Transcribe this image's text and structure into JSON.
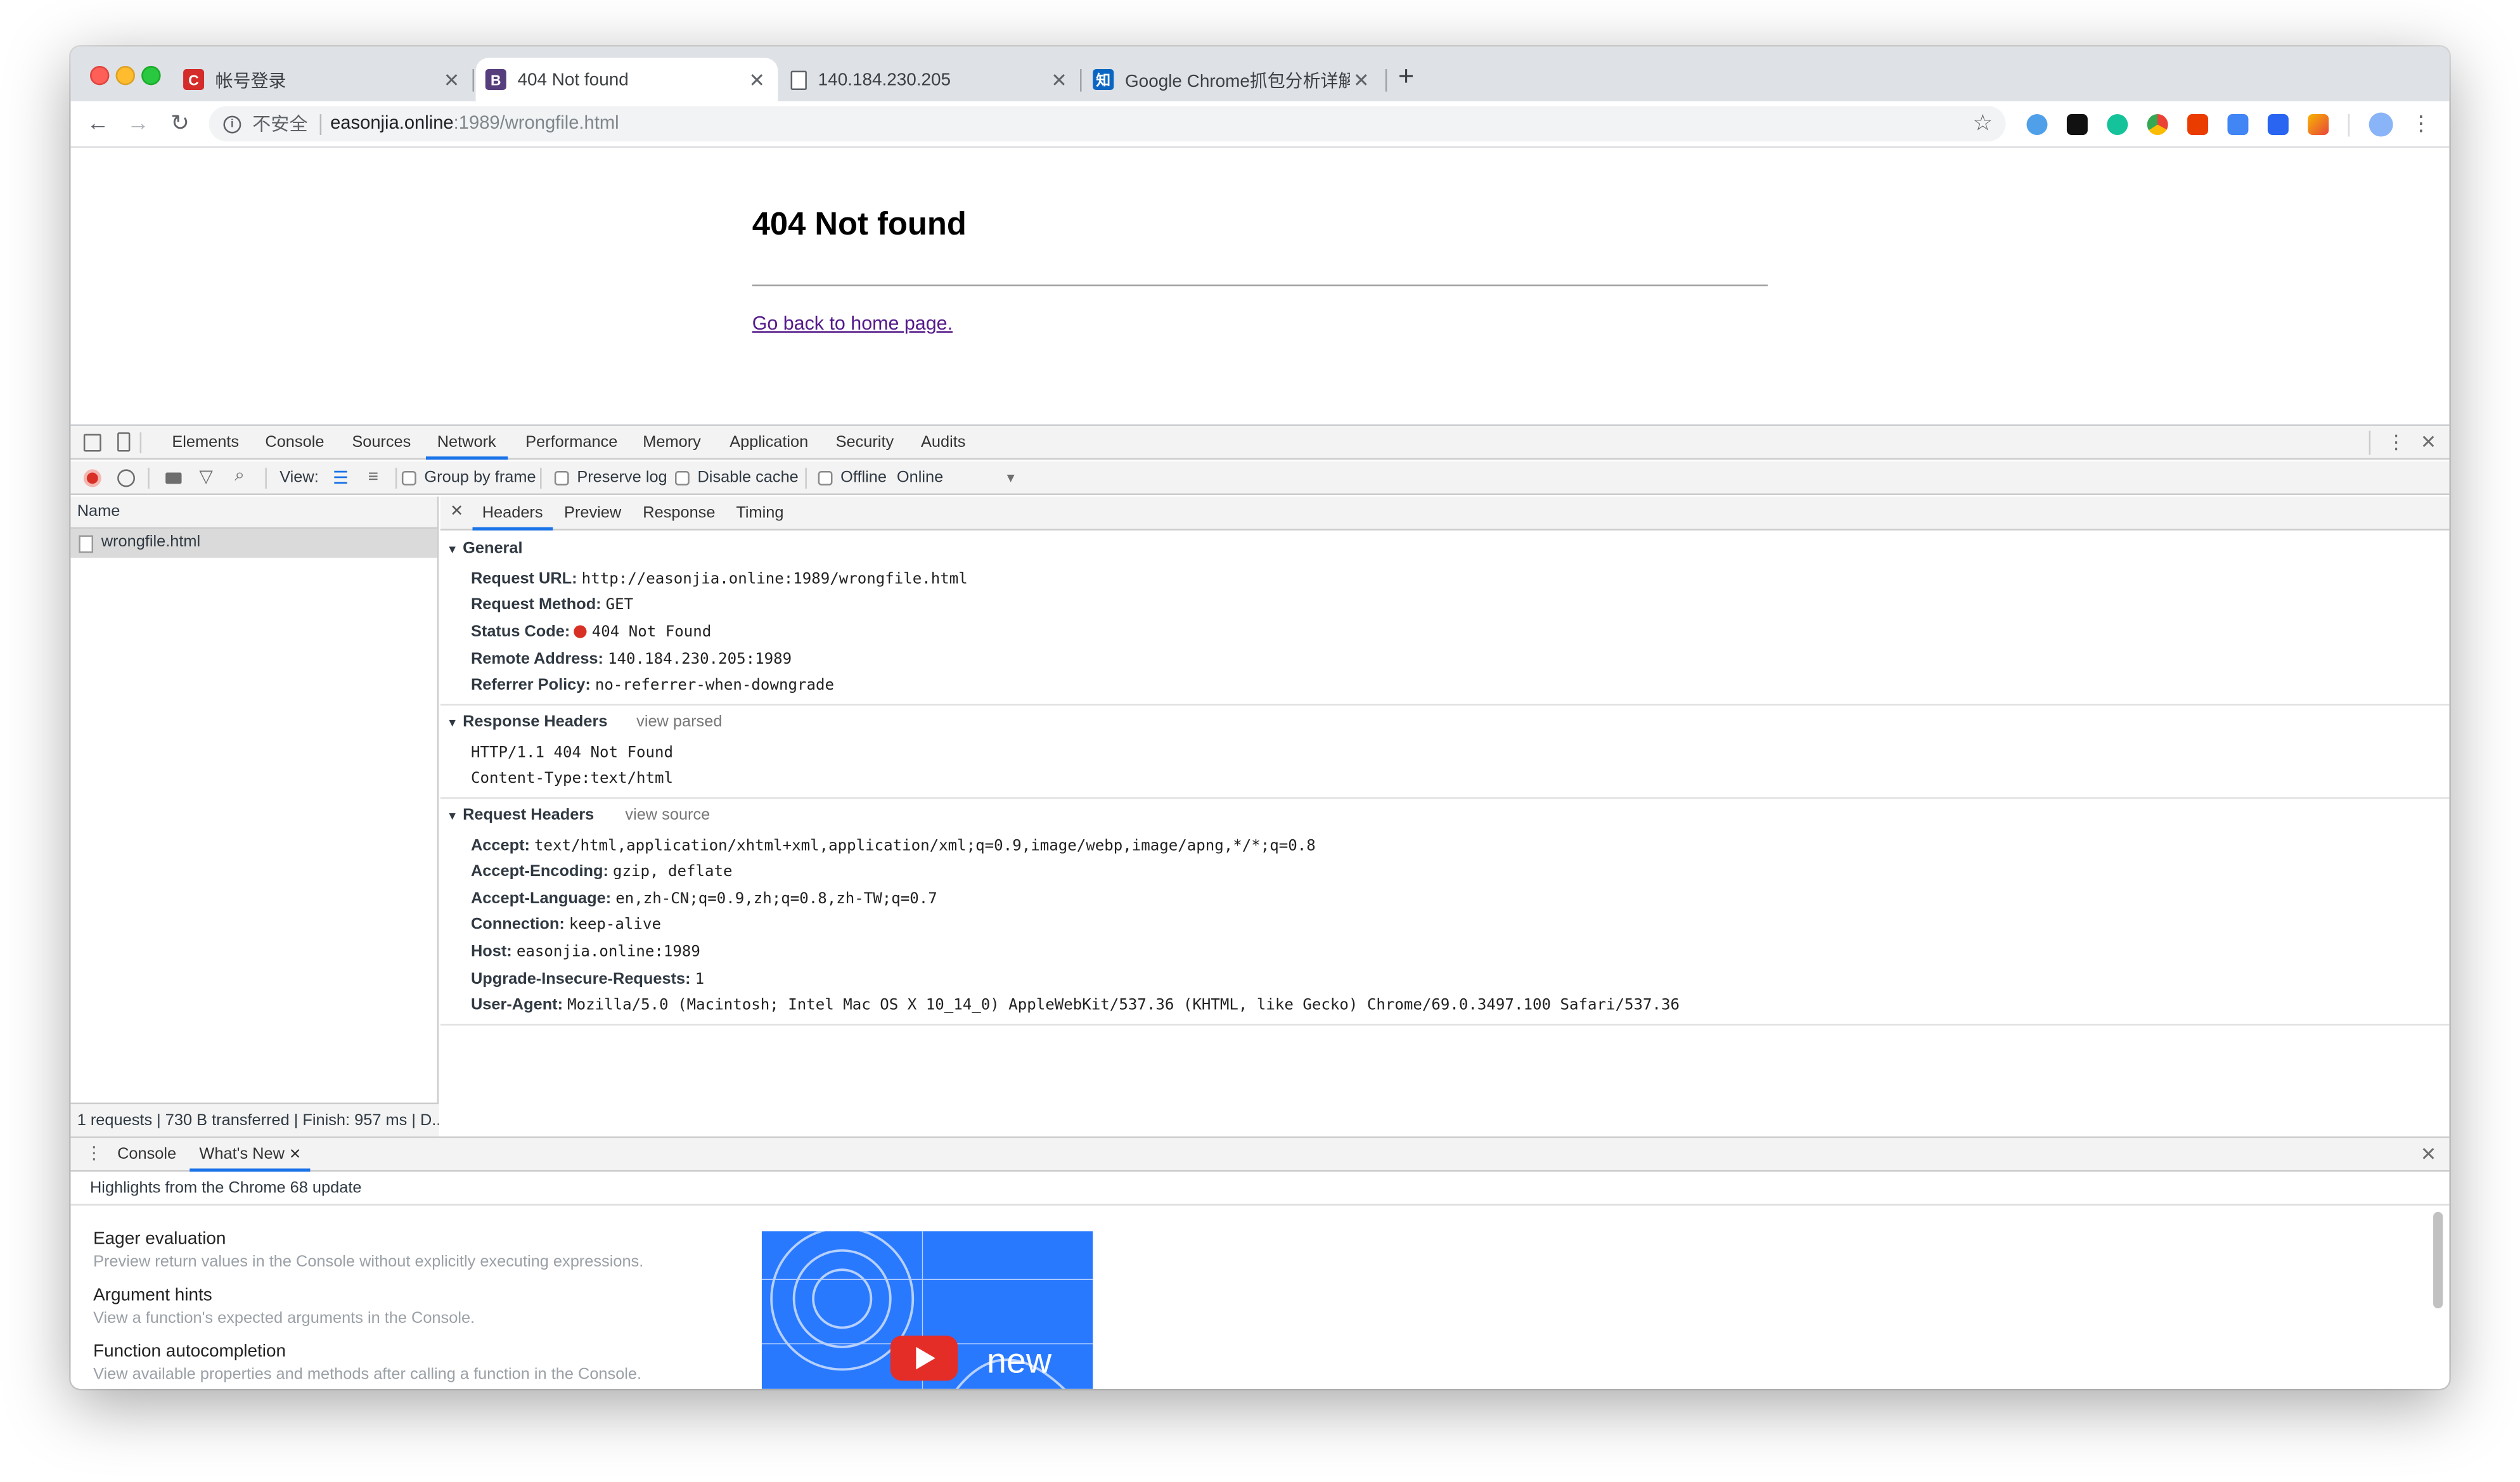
{
  "browser": {
    "tabs": [
      {
        "title": "帐号登录",
        "favicon": "C",
        "favicon_color": "#d42b2b"
      },
      {
        "title": "404 Not found",
        "favicon": "B",
        "favicon_color": "#563d7c"
      },
      {
        "title": "140.184.230.205",
        "favicon": "page-icon",
        "favicon_color": "#5f6368"
      },
      {
        "title": "Google Chrome抓包分析详解",
        "favicon": "知",
        "favicon_color": "#0a66c2"
      }
    ],
    "new_tab": "+",
    "address": {
      "security_label": "不安全",
      "host": "easonjia.online",
      "path": ":1989/wrongfile.html"
    }
  },
  "page": {
    "heading": "404 Not found",
    "link": "Go back to home page."
  },
  "devtools": {
    "tabs": [
      "Elements",
      "Console",
      "Sources",
      "Network",
      "Performance",
      "Memory",
      "Application",
      "Security",
      "Audits"
    ],
    "active_tab": "Network",
    "network_toolbar": {
      "view_label": "View:",
      "group_by_frame": "Group by frame",
      "preserve_log": "Preserve log",
      "disable_cache": "Disable cache",
      "offline": "Offline",
      "throttle": "Online"
    },
    "requests": {
      "header": "Name",
      "items": [
        "wrongfile.html"
      ],
      "status_bar": "1 requests | 730 B transferred | Finish: 957 ms | D..."
    },
    "detail_tabs": [
      "Headers",
      "Preview",
      "Response",
      "Timing"
    ],
    "general": {
      "title": "General",
      "rows": [
        {
          "k": "Request URL:",
          "v": "http://easonjia.online:1989/wrongfile.html"
        },
        {
          "k": "Request Method:",
          "v": "GET"
        },
        {
          "k": "Status Code:",
          "v": "404 Not Found"
        },
        {
          "k": "Remote Address:",
          "v": "140.184.230.205:1989"
        },
        {
          "k": "Referrer Policy:",
          "v": "no-referrer-when-downgrade"
        }
      ]
    },
    "response_headers": {
      "title": "Response Headers",
      "toggle": "view parsed",
      "lines": [
        "HTTP/1.1 404 Not Found",
        "Content-Type:text/html"
      ]
    },
    "request_headers": {
      "title": "Request Headers",
      "toggle": "view source",
      "rows": [
        {
          "k": "Accept:",
          "v": "text/html,application/xhtml+xml,application/xml;q=0.9,image/webp,image/apng,*/*;q=0.8"
        },
        {
          "k": "Accept-Encoding:",
          "v": "gzip, deflate"
        },
        {
          "k": "Accept-Language:",
          "v": "en,zh-CN;q=0.9,zh;q=0.8,zh-TW;q=0.7"
        },
        {
          "k": "Connection:",
          "v": "keep-alive"
        },
        {
          "k": "Host:",
          "v": "easonjia.online:1989"
        },
        {
          "k": "Upgrade-Insecure-Requests:",
          "v": "1"
        },
        {
          "k": "User-Agent:",
          "v": "Mozilla/5.0 (Macintosh; Intel Mac OS X 10_14_0) AppleWebKit/537.36 (KHTML, like Gecko) Chrome/69.0.3497.100 Safari/537.36"
        }
      ]
    },
    "drawer": {
      "tabs": [
        "Console",
        "What's New"
      ],
      "active_tab": "What's New",
      "subtitle": "Highlights from the Chrome 68 update",
      "items": [
        {
          "title": "Eager evaluation",
          "desc": "Preview return values in the Console without explicitly executing expressions."
        },
        {
          "title": "Argument hints",
          "desc": "View a function's expected arguments in the Console."
        },
        {
          "title": "Function autocompletion",
          "desc": "View available properties and methods after calling a function in the Console."
        }
      ],
      "video_text": "new"
    }
  },
  "colors": {
    "accent": "#1a73e8",
    "record_red": "#d93025",
    "link": "#551a8b",
    "video_blue": "#2979ff"
  }
}
